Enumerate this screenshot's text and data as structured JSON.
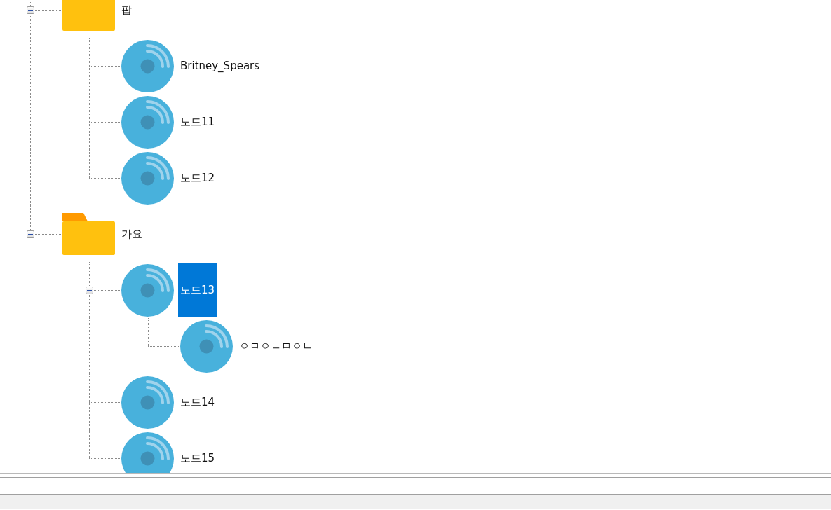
{
  "tree": {
    "nodes": [
      {
        "kind": "folder",
        "label": "팝",
        "selected": false,
        "expanded": true,
        "children": [
          {
            "kind": "disc",
            "label": "Britney_Spears",
            "selected": false
          },
          {
            "kind": "disc",
            "label": "노드11",
            "selected": false
          },
          {
            "kind": "disc",
            "label": "노드12",
            "selected": false
          }
        ]
      },
      {
        "kind": "folder",
        "label": "가요",
        "selected": false,
        "expanded": true,
        "children": [
          {
            "kind": "disc",
            "label": "노드13",
            "selected": true,
            "expanded": true,
            "children": [
              {
                "kind": "disc",
                "label": "ㅇㅁㅇㄴㅁㅇㄴ",
                "selected": false
              }
            ]
          },
          {
            "kind": "disc",
            "label": "노드14",
            "selected": false
          },
          {
            "kind": "disc",
            "label": "노드15",
            "selected": false
          }
        ]
      }
    ]
  }
}
